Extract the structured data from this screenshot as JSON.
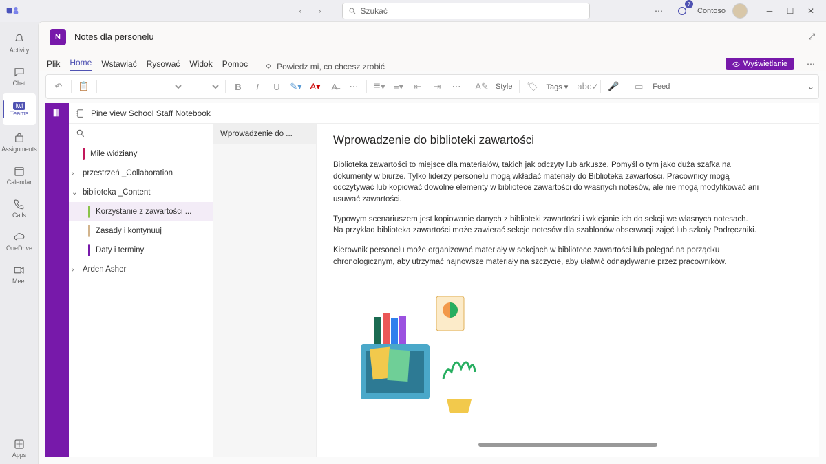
{
  "titlebar": {
    "search_placeholder": "Szukać",
    "org": "Contoso",
    "notif_count": "7"
  },
  "rail": [
    {
      "label": "Activity",
      "icon": "bell"
    },
    {
      "label": "Chat",
      "icon": "chat"
    },
    {
      "label": "Teams",
      "icon": "people",
      "active": true,
      "pill": "iwi"
    },
    {
      "label": "Assignments",
      "icon": "bag"
    },
    {
      "label": "Calendar",
      "icon": "calendar"
    },
    {
      "label": "Calls",
      "icon": "phone"
    },
    {
      "label": "OneDrive",
      "icon": "cloud"
    },
    {
      "label": "Meet",
      "icon": "video"
    }
  ],
  "rail_more": "...",
  "rail_apps": "Apps",
  "app_header": {
    "title": "Notes dla personelu"
  },
  "ribbon": {
    "tabs": [
      "Plik",
      "Home",
      "Wstawiać",
      "Rysować",
      "Widok",
      "Pomoc"
    ],
    "active": "Home",
    "tellme": "Powiedz mi, co chcesz zrobić",
    "view_mode": "Wyświetlanie"
  },
  "toolbar": {
    "style": "Style",
    "tags": "Tags",
    "feed": "Feed"
  },
  "notebook": {
    "name": "Pine view School Staff Notebook",
    "sections": [
      {
        "label": "Mile widziany",
        "color": "#c2185b",
        "chev": ""
      },
      {
        "label": "przestrzeń _Collaboration",
        "chev": "›",
        "indent": true
      },
      {
        "label": "biblioteka _Content",
        "chev": "⌄",
        "indent": true
      },
      {
        "label": "Korzystanie z zawartości ...",
        "color": "#8bc34a",
        "sub": true,
        "active": true
      },
      {
        "label": "Zasady i kontynuuj",
        "color": "#d2b48c",
        "sub": true
      },
      {
        "label": "Daty i terminy",
        "color": "#7719aa",
        "sub": true
      },
      {
        "label": "Arden Asher",
        "chev": "›",
        "indent": true
      }
    ],
    "page_tab": "Wprowadzenie do ..."
  },
  "document": {
    "title": "Wprowadzenie do biblioteki zawartości",
    "p1": "Biblioteka zawartości to miejsce dla materiałów, takich jak odczyty lub arkusze.        Pomyśl o tym jako duża szafka na dokumenty w biurze. Tylko liderzy personelu mogą wkładać materiały do Biblioteka zawartości. Pracownicy mogą odczytywać lub kopiować dowolne elementy w bibliotece zawartości do własnych notesów, ale nie mogą modyfikować ani usuwać zawartości.",
    "p2": "Typowym scenariuszem jest kopiowanie danych z biblioteki zawartości i wklejanie ich do sekcji we własnych notesach. Na przykład biblioteka zawartości może zawierać sekcje notesów dla szablonów obserwacji zajęć lub szkoły Podręczniki.",
    "p3": "Kierownik personelu może organizować materiały w sekcjach w bibliotece zawartości lub polegać na porządku chronologicznym, aby utrzymać najnowsze materiały na szczycie, aby ułatwić odnajdywanie przez pracowników."
  }
}
